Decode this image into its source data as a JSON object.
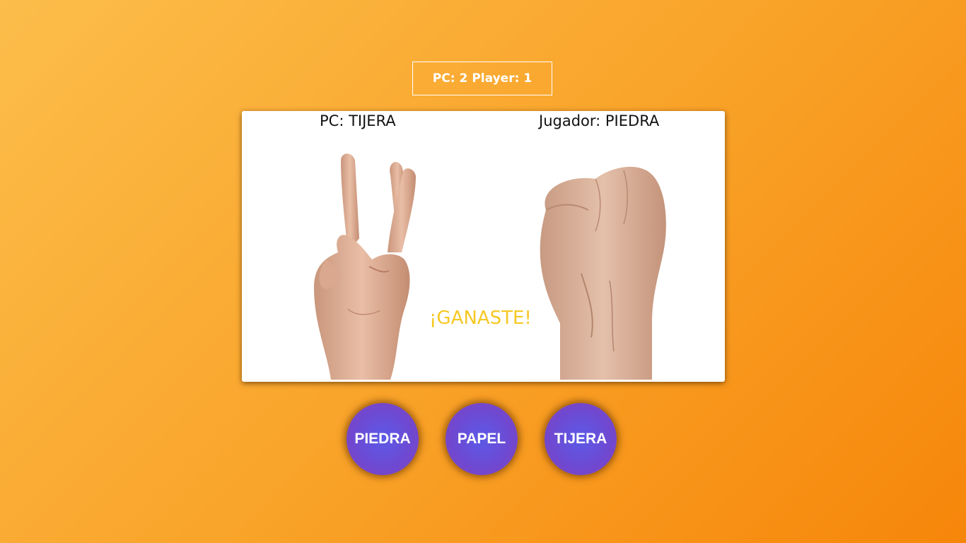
{
  "score": {
    "pc_label": "PC:",
    "pc_value": "2",
    "player_label": "Player:",
    "player_value": "1"
  },
  "arena": {
    "pc_choice_text": "PC: TIJERA",
    "player_choice_text": "Jugador: PIEDRA",
    "pc_hand_icon": "scissors-hand-icon",
    "player_hand_icon": "rock-fist-icon",
    "result_text": "¡GANASTE!"
  },
  "buttons": {
    "piedra": "PIEDRA",
    "papel": "PAPEL",
    "tijera": "TIJERA"
  },
  "colors": {
    "background_start": "#fcbd4a",
    "background_end": "#f6860a",
    "result": "#f6c823",
    "button_center": "#5b5ae8",
    "button_edge": "#8444b8"
  }
}
